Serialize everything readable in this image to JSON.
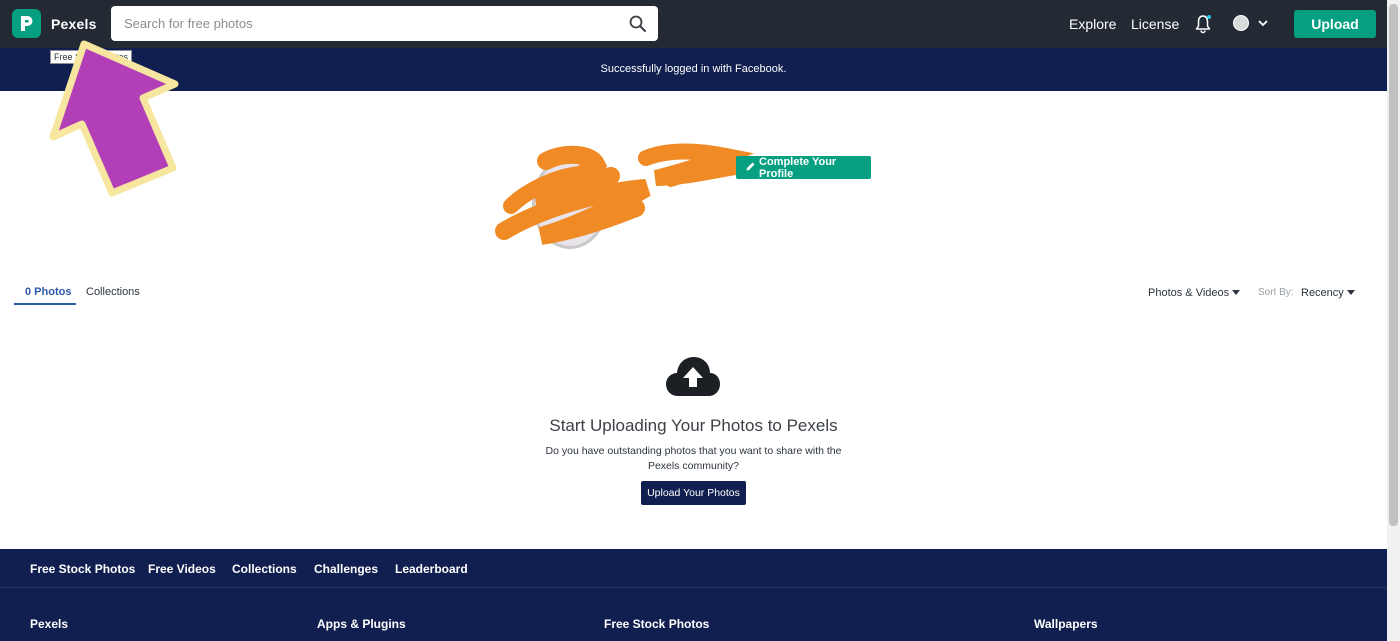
{
  "header": {
    "brand": "Pexels",
    "search_placeholder": "Search for free photos",
    "nav": [
      {
        "label": "Explore"
      },
      {
        "label": "License"
      }
    ],
    "upload_label": "Upload",
    "logo_icon": "pexels-logo-icon",
    "search_icon": "search-icon",
    "bell_icon": "bell-icon",
    "accent_color": "#05a081",
    "header_bg": "#232a34"
  },
  "tooltip": {
    "text": "Free Stock Photos"
  },
  "flash": {
    "message": "Successfully logged in with Facebook.",
    "bg": "#101f4f"
  },
  "profile": {
    "name": "",
    "complete_profile_label": "Complete Your Profile"
  },
  "tabs": [
    {
      "label": "0 Photos",
      "active": true
    },
    {
      "label": "Collections",
      "active": false
    }
  ],
  "filters": {
    "media_type": "Photos & Videos",
    "sort_label": "Sort By:",
    "sort_value": "Recency"
  },
  "empty_state": {
    "title": "Start Uploading Your Photos to Pexels",
    "description_line1": "Do you have outstanding photos that you want to share with the",
    "description_line2": "Pexels community?",
    "button_label": "Upload Your Photos",
    "icon": "cloud-upload-icon"
  },
  "footer": {
    "links": [
      {
        "label": "Free Stock Photos"
      },
      {
        "label": "Free Videos"
      },
      {
        "label": "Collections"
      },
      {
        "label": "Challenges"
      },
      {
        "label": "Leaderboard"
      }
    ],
    "columns": [
      {
        "heading": "Pexels"
      },
      {
        "heading": "Apps & Plugins"
      },
      {
        "heading": "Free Stock Photos"
      },
      {
        "heading": "Wallpapers"
      }
    ]
  }
}
